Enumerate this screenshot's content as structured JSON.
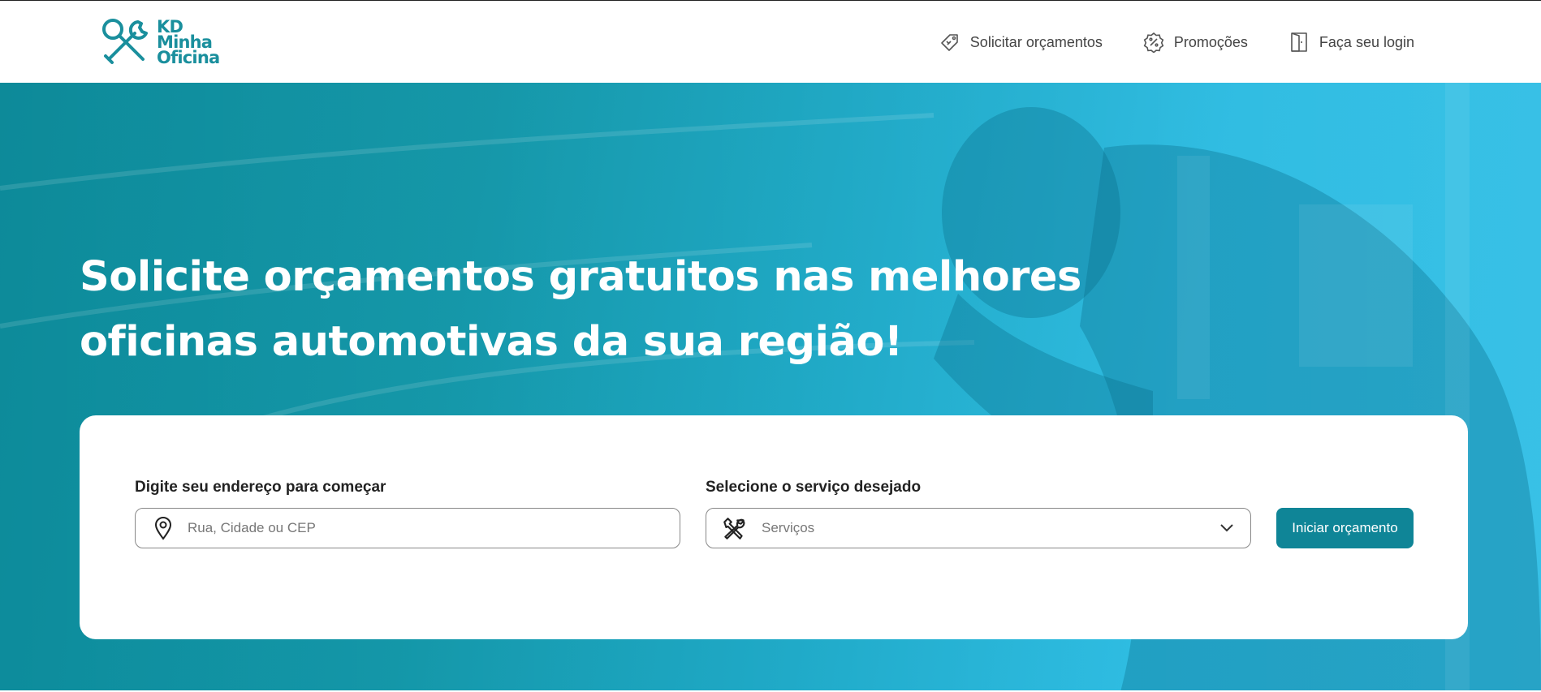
{
  "brand": {
    "logo_lines": [
      "KD",
      "Minha",
      "Oficina"
    ],
    "color": "#1a8f9d"
  },
  "nav": {
    "items": [
      {
        "label": "Solicitar orçamentos",
        "icon": "price-tag-icon"
      },
      {
        "label": "Promoções",
        "icon": "discount-badge-icon"
      },
      {
        "label": "Faça seu login",
        "icon": "door-login-icon"
      }
    ]
  },
  "hero": {
    "title_lines": [
      "Solicite orçamentos gratuitos nas melhores",
      "oficinas automotivas da sua região!"
    ]
  },
  "search": {
    "address_label": "Digite seu endereço para começar",
    "address_placeholder": "Rua, Cidade ou CEP",
    "address_value": "",
    "service_label": "Selecione o serviço desejado",
    "service_selected": "Serviços",
    "submit_label": "Iniciar orçamento"
  },
  "colors": {
    "accent": "#0f8597",
    "hero_start": "#0d8a99",
    "hero_end": "#1db9e4"
  }
}
